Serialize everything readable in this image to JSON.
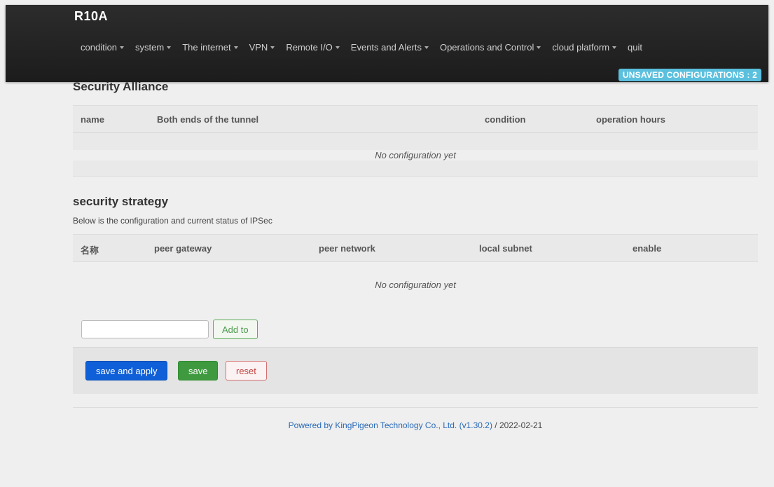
{
  "header": {
    "brand": "R10A",
    "menu": [
      {
        "label": "condition",
        "dropdown": true
      },
      {
        "label": "system",
        "dropdown": true
      },
      {
        "label": "The internet",
        "dropdown": true
      },
      {
        "label": "VPN",
        "dropdown": true
      },
      {
        "label": "Remote I/O",
        "dropdown": true
      },
      {
        "label": "Events and Alerts",
        "dropdown": true
      },
      {
        "label": "Operations and Control",
        "dropdown": true
      },
      {
        "label": "cloud platform",
        "dropdown": true
      },
      {
        "label": "quit",
        "dropdown": false
      }
    ],
    "unsaved_badge": "UNSAVED CONFIGURATIONS : 2"
  },
  "security_alliance": {
    "title": "Security Alliance",
    "columns": [
      "name",
      "Both ends of the tunnel",
      "condition",
      "operation hours"
    ],
    "empty_text": "No configuration yet"
  },
  "security_strategy": {
    "title": "security strategy",
    "description": "Below is the configuration and current status of IPSec",
    "columns": [
      "名称",
      "peer gateway",
      "peer network",
      "local subnet",
      "enable"
    ],
    "empty_text": "No configuration yet",
    "add_input_value": "",
    "add_button": "Add to"
  },
  "actions": {
    "save_and_apply": "save and apply",
    "save": "save",
    "reset": "reset"
  },
  "footer": {
    "link_text": "Powered by KingPigeon Technology Co., Ltd. (v1.30.2)",
    "date_text": " / 2022-02-21"
  },
  "colors": {
    "navbar": "#1c1c1c",
    "badge": "#5bc0de",
    "apply": "#0e5fd8",
    "save": "#3f9a3f",
    "reset": "#c24040"
  }
}
